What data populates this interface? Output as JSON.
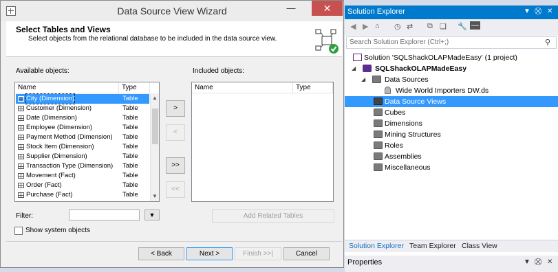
{
  "wizard": {
    "title": "Data Source View Wizard",
    "heading": "Select Tables and Views",
    "subheading": "Select objects from the relational database to be included in the data source view.",
    "available_label": "Available objects:",
    "included_label": "Included objects:",
    "columns": {
      "name": "Name",
      "type": "Type"
    },
    "available_objects": [
      {
        "name": "City (Dimension)",
        "type": "Table"
      },
      {
        "name": "Customer (Dimension)",
        "type": "Table"
      },
      {
        "name": "Date (Dimension)",
        "type": "Table"
      },
      {
        "name": "Employee (Dimension)",
        "type": "Table"
      },
      {
        "name": "Payment Method (Dimension)",
        "type": "Table"
      },
      {
        "name": "Stock Item (Dimension)",
        "type": "Table"
      },
      {
        "name": "Supplier (Dimension)",
        "type": "Table"
      },
      {
        "name": "Transaction Type (Dimension)",
        "type": "Table"
      },
      {
        "name": "Movement (Fact)",
        "type": "Table"
      },
      {
        "name": "Order (Fact)",
        "type": "Table"
      },
      {
        "name": "Purchase (Fact)",
        "type": "Table"
      }
    ],
    "buttons": {
      "add": ">",
      "remove": "<",
      "add_all": ">>",
      "remove_all": "<<",
      "add_related": "Add Related Tables",
      "back": "< Back",
      "next": "Next >",
      "finish": "Finish >>|",
      "cancel": "Cancel"
    },
    "filter_label": "Filter:",
    "show_system_objects": "Show system objects"
  },
  "solution_explorer": {
    "title": "Solution Explorer",
    "search_placeholder": "Search Solution Explorer (Ctrl+;)",
    "tree": [
      {
        "label": "Solution 'SQLShackOLAPMadeEasy' (1 project)",
        "icon": "solution-icon",
        "bold": false
      },
      {
        "label": "SQLShackOLAPMadeEasy",
        "icon": "project-icon",
        "bold": true
      },
      {
        "label": "Data Sources",
        "icon": "folder-icon"
      },
      {
        "label": "Wide World Importers DW.ds",
        "icon": "datasource-icon"
      },
      {
        "label": "Data Source Views",
        "icon": "folder-icon",
        "selected": true
      },
      {
        "label": "Cubes",
        "icon": "folder-icon"
      },
      {
        "label": "Dimensions",
        "icon": "folder-icon"
      },
      {
        "label": "Mining Structures",
        "icon": "folder-icon"
      },
      {
        "label": "Roles",
        "icon": "folder-icon"
      },
      {
        "label": "Assemblies",
        "icon": "folder-icon"
      },
      {
        "label": "Miscellaneous",
        "icon": "folder-icon"
      }
    ],
    "tabs": [
      "Solution Explorer",
      "Team Explorer",
      "Class View"
    ],
    "properties_title": "Properties",
    "accent": "#007acc",
    "selection": "#3399ff"
  }
}
